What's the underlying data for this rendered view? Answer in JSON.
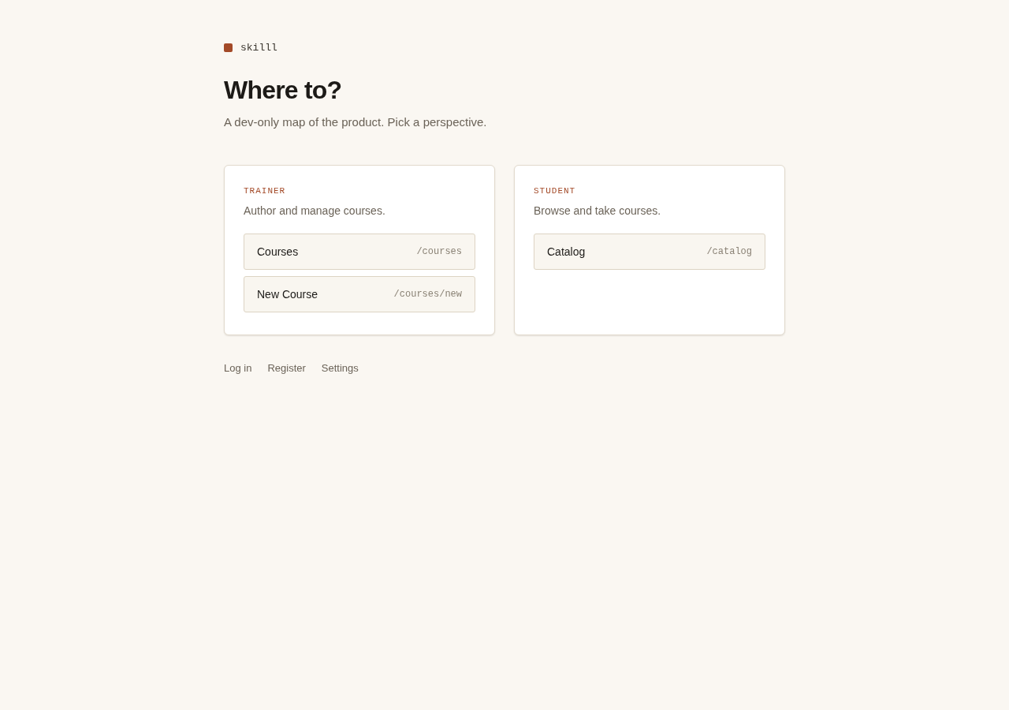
{
  "brand": {
    "name": "skilll"
  },
  "heading": "Where to?",
  "subtitle": "A dev-only map of the product. Pick a perspective.",
  "perspectives": [
    {
      "label": "TRAINER",
      "description": "Author and manage courses.",
      "links": [
        {
          "label": "Courses",
          "path": "/courses"
        },
        {
          "label": "New Course",
          "path": "/courses/new"
        }
      ]
    },
    {
      "label": "STUDENT",
      "description": "Browse and take courses.",
      "links": [
        {
          "label": "Catalog",
          "path": "/catalog"
        }
      ]
    }
  ],
  "footer_links": [
    "Log in",
    "Register",
    "Settings"
  ]
}
